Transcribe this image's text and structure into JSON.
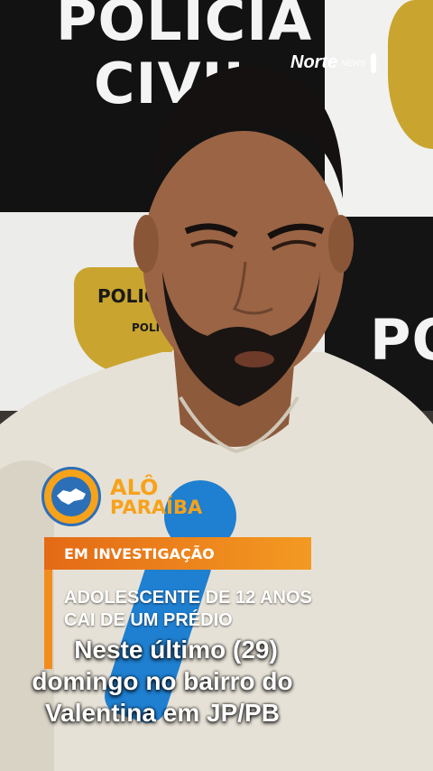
{
  "background": {
    "wall_text_top_line1": "POLICIA",
    "wall_text_top_line2": "CIVIL",
    "wall_text_right": "PO",
    "badge_label": "POLICIA",
    "badge_label_small": "POLICIA"
  },
  "watermark": {
    "brand": "Norte",
    "sub": "NEWS"
  },
  "logo": {
    "line1": "ALÔ",
    "line2": "PARAÍBA"
  },
  "tag": {
    "label": "EM INVESTIGAÇÃO"
  },
  "headline": {
    "line1": "ADOLESCENTE DE 12 ANOS",
    "line2": "CAI DE UM PRÉDIO"
  },
  "caption": {
    "line1": "Neste último (29)",
    "line2": "domingo no bairro do",
    "line3": "Valentina em JP/PB"
  },
  "colors": {
    "accent_orange": "#f28c1c",
    "brand_blue": "#2d6fb7",
    "microphone_blue": "#1f7fd0"
  }
}
